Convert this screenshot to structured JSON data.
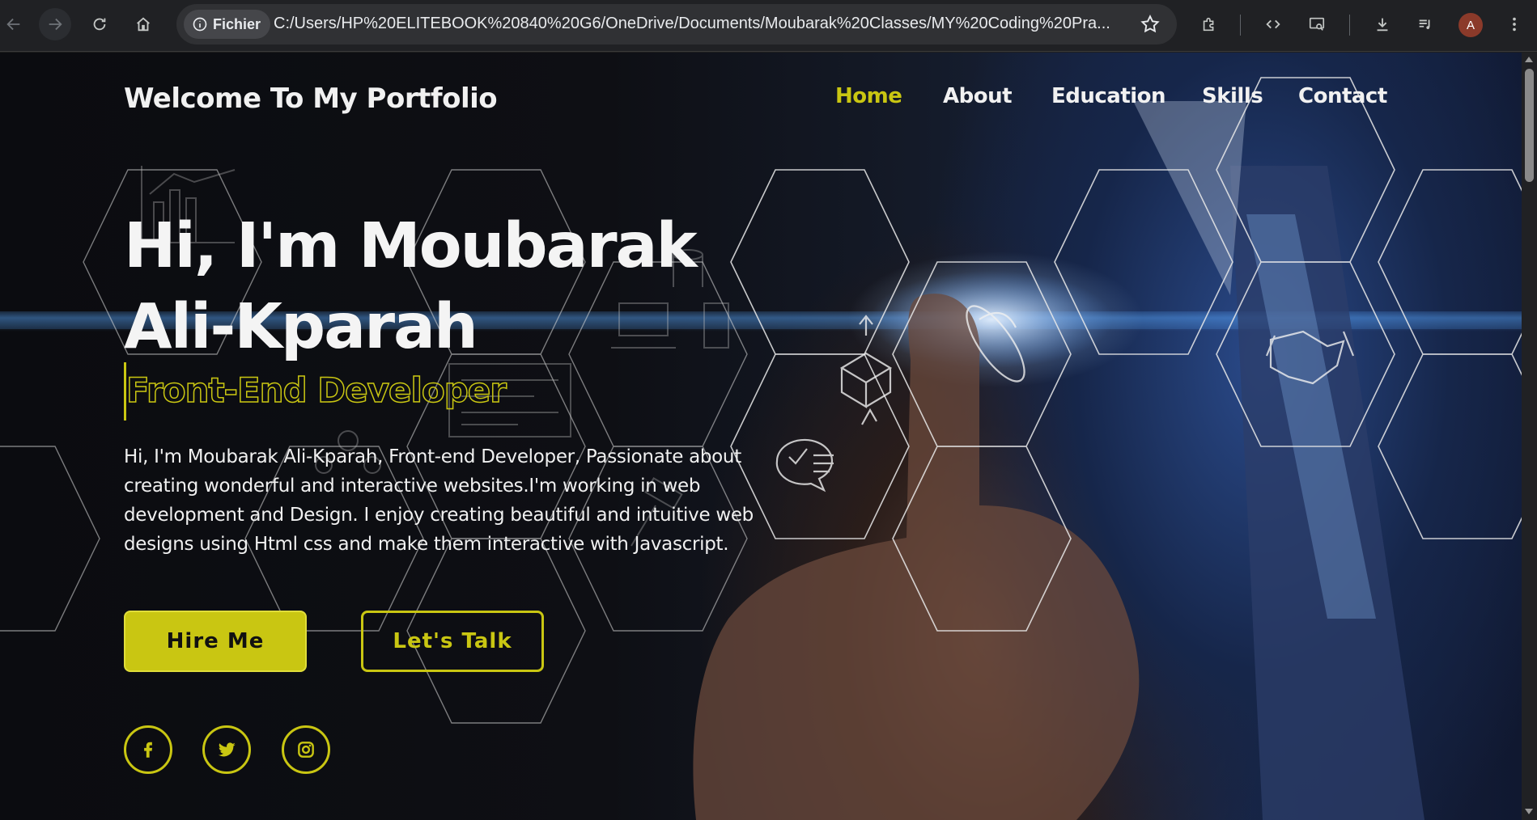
{
  "browser": {
    "site_info_label": "Fichier",
    "url": "C:/Users/HP%20ELITEBOOK%20840%20G6/OneDrive/Documents/Moubarak%20Classes/MY%20Coding%20Pra...",
    "profile_initial": "A"
  },
  "header": {
    "title": "Welcome To My Portfolio",
    "nav": [
      {
        "label": "Home",
        "active": true
      },
      {
        "label": "About"
      },
      {
        "label": "Education"
      },
      {
        "label": "Skills"
      },
      {
        "label": "Contact"
      }
    ]
  },
  "hero": {
    "heading": "Hi, I'm Moubarak Ali-Kparah",
    "role": "Front-End Developer",
    "intro": "Hi, I'm Moubarak Ali-Kparah, Front-end Developer, Passionate about creating wonderful and interactive websites.I'm working in web development and Design. I enjoy creating beautiful and intuitive web designs using Html css and make them interactive with Javascript.",
    "hire_label": "Hire Me",
    "talk_label": "Let's Talk"
  },
  "social": [
    "facebook-icon",
    "twitter-icon",
    "instagram-icon"
  ],
  "colors": {
    "accent": "#c9c612",
    "text": "#f1f1f1",
    "chrome_bg": "#202124"
  }
}
